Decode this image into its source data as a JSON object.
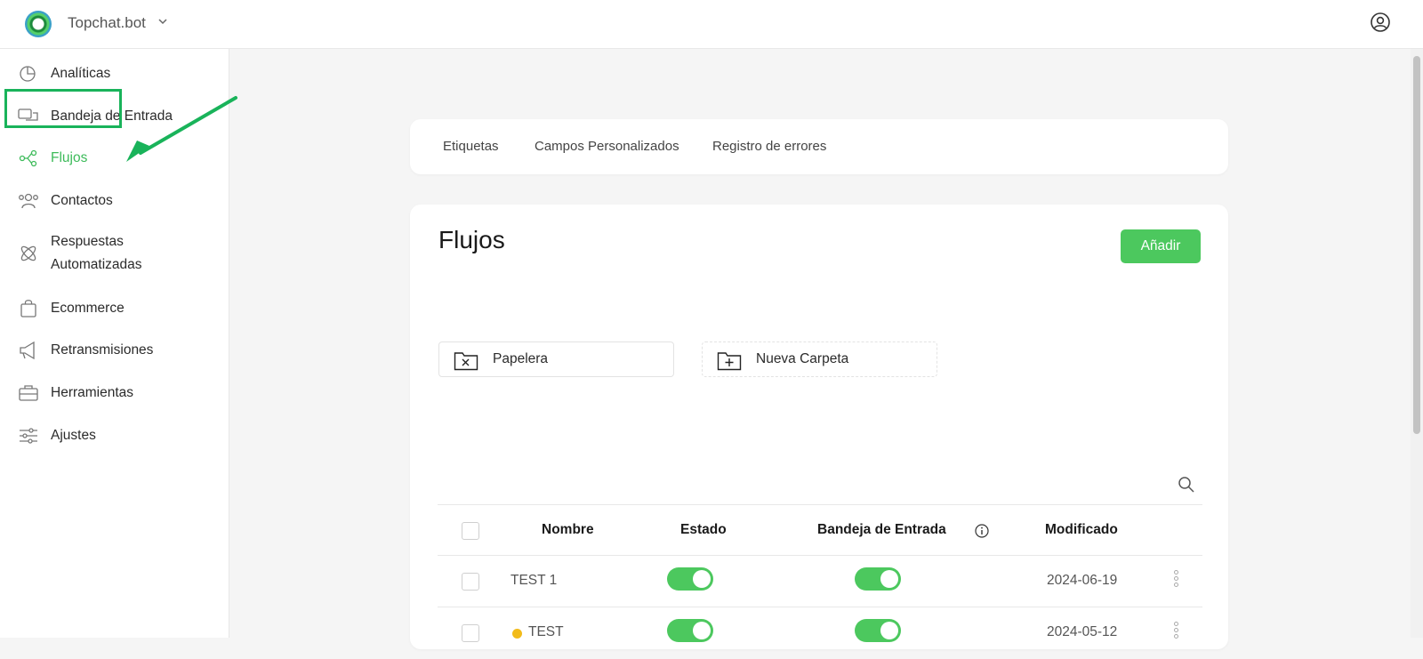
{
  "app": {
    "brand": "Topchat.bot"
  },
  "sidebar": {
    "items": [
      {
        "label": "Analíticas",
        "icon": "pie-chart-icon"
      },
      {
        "label": "Bandeja de Entrada",
        "icon": "chat-bubbles-icon"
      },
      {
        "label": "Flujos",
        "icon": "share-nodes-icon",
        "active": true
      },
      {
        "label": "Contactos",
        "icon": "users-icon"
      },
      {
        "label": "Respuestas",
        "label2": "Automatizadas",
        "icon": "atom-icon"
      },
      {
        "label": "Ecommerce",
        "icon": "shopping-bag-icon"
      },
      {
        "label": "Retransmisiones",
        "icon": "megaphone-icon"
      },
      {
        "label": "Herramientas",
        "icon": "toolbox-icon"
      },
      {
        "label": "Ajustes",
        "icon": "sliders-icon"
      }
    ]
  },
  "tabs": [
    "Etiquetas",
    "Campos Personalizados",
    "Registro de errores"
  ],
  "main": {
    "title": "Flujos",
    "add_label": "Añadir",
    "folders": [
      {
        "label": "Papelera",
        "icon": "folder-x-icon"
      },
      {
        "label": "Nueva Carpeta",
        "icon": "folder-plus-icon"
      }
    ]
  },
  "table": {
    "headers": {
      "name": "Nombre",
      "status": "Estado",
      "inbox": "Bandeja de Entrada",
      "modified": "Modificado"
    },
    "rows": [
      {
        "name": "TEST 1",
        "status_on": true,
        "inbox_on": true,
        "modified": "2024-06-19",
        "dot": false
      },
      {
        "name": "TEST",
        "status_on": true,
        "inbox_on": true,
        "modified": "2024-05-12",
        "dot": true
      }
    ]
  },
  "colors": {
    "accent": "#4cc85e",
    "highlight": "#19b35a",
    "dot": "#f2bb1a"
  }
}
